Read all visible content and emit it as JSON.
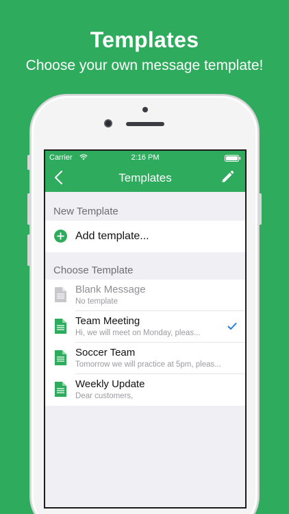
{
  "promo": {
    "title": "Templates",
    "subtitle": "Choose your own message template!"
  },
  "status_bar": {
    "carrier": "Carrier",
    "time": "2:16 PM"
  },
  "nav": {
    "title": "Templates"
  },
  "new_section": {
    "header": "New Template",
    "add_label": "Add template..."
  },
  "choose_section": {
    "header": "Choose Template",
    "templates": [
      {
        "title": "Blank Message",
        "subtitle": "No template",
        "selected": false,
        "disabled": true
      },
      {
        "title": "Team Meeting",
        "subtitle": "Hi, we will meet on Monday, pleas...",
        "selected": true,
        "disabled": false
      },
      {
        "title": "Soccer Team",
        "subtitle": "Tomorrow we will practice at 5pm, pleas...",
        "selected": false,
        "disabled": false
      },
      {
        "title": "Weekly Update",
        "subtitle": "Dear customers,",
        "selected": false,
        "disabled": false
      }
    ]
  },
  "colors": {
    "accent": "#2eab5c",
    "check": "#1f7fe0",
    "disabled_icon": "#c7c7cc"
  },
  "icons": {
    "back": "chevron-left-icon",
    "edit": "pencil-icon",
    "add": "plus-circle-icon",
    "document": "document-icon",
    "check": "checkmark-icon"
  }
}
